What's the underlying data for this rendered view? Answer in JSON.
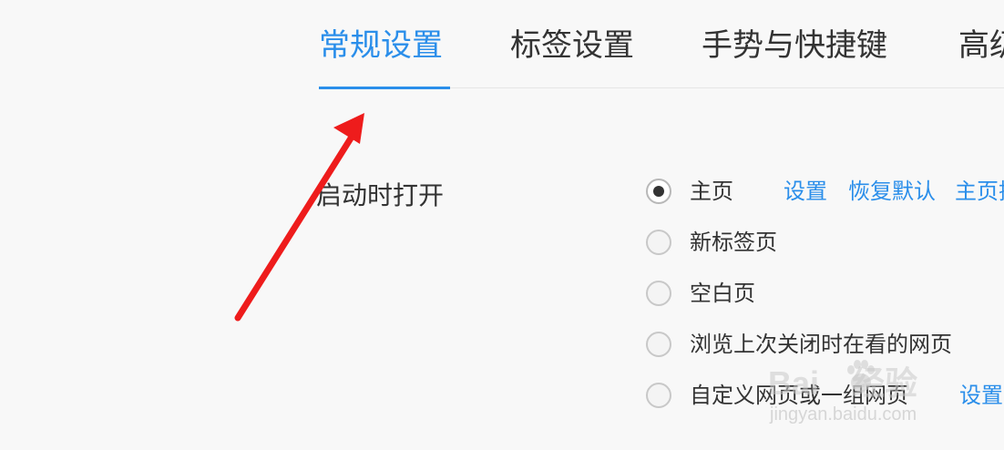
{
  "tabs": [
    {
      "label": "常规设置",
      "active": true
    },
    {
      "label": "标签设置",
      "active": false
    },
    {
      "label": "手势与快捷键",
      "active": false
    },
    {
      "label": "高级",
      "active": false
    }
  ],
  "startup": {
    "label": "启动时打开",
    "options": [
      {
        "label": "主页",
        "checked": true
      },
      {
        "label": "新标签页",
        "checked": false
      },
      {
        "label": "空白页",
        "checked": false
      },
      {
        "label": "浏览上次关闭时在看的网页",
        "checked": false
      },
      {
        "label": "自定义网页或一组网页",
        "checked": false
      }
    ],
    "homepage_links": {
      "set": "设置",
      "restore_default": "恢复默认",
      "homepage_more": "主页搜"
    },
    "custom_link": "设置"
  },
  "watermark": {
    "brand": "Bai",
    "brand_suffix": "经验",
    "url": "jingyan.baidu.com"
  },
  "colors": {
    "accent": "#2a8eea",
    "annotation_arrow": "#ee1c1c",
    "background": "#f8f8f8"
  }
}
